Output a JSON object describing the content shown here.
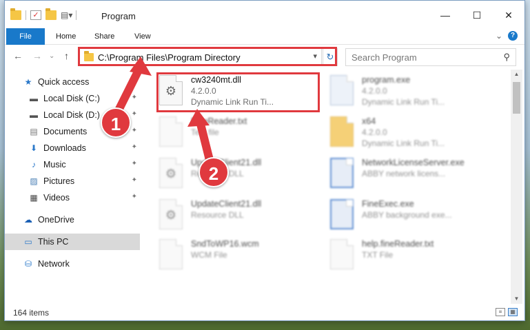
{
  "window": {
    "title": "Program",
    "controls": {
      "minimize": "—",
      "maximize": "☐",
      "close": "✕"
    }
  },
  "ribbon": {
    "tabs": [
      "File",
      "Home",
      "Share",
      "View"
    ],
    "help": "?",
    "collapse": "⌄"
  },
  "nav": {
    "back": "←",
    "forward": "→",
    "recent": "⌄",
    "up": "↑",
    "address": "C:\\Program Files\\Program Directory",
    "refresh": "↻"
  },
  "search": {
    "placeholder": "Search Program",
    "icon": "⚲"
  },
  "sidebar": {
    "items": [
      {
        "label": "Quick access",
        "icon": "star-icon",
        "glyph": "★",
        "pinned": false
      },
      {
        "label": "Local Disk (C:)",
        "icon": "drive-icon",
        "glyph": "▬",
        "pinned": true
      },
      {
        "label": "Local Disk (D:)",
        "icon": "drive-icon",
        "glyph": "▬",
        "pinned": true
      },
      {
        "label": "Documents",
        "icon": "documents-icon",
        "glyph": "▤",
        "pinned": true
      },
      {
        "label": "Downloads",
        "icon": "download-icon",
        "glyph": "⬇",
        "pinned": true
      },
      {
        "label": "Music",
        "icon": "music-icon",
        "glyph": "♪",
        "pinned": true
      },
      {
        "label": "Pictures",
        "icon": "pictures-icon",
        "glyph": "▨",
        "pinned": true
      },
      {
        "label": "Videos",
        "icon": "videos-icon",
        "glyph": "▦",
        "pinned": true
      },
      {
        "label": "OneDrive",
        "icon": "cloud-icon",
        "glyph": "☁",
        "pinned": false
      },
      {
        "label": "This PC",
        "icon": "computer-icon",
        "glyph": "▭",
        "pinned": false,
        "selected": true
      },
      {
        "label": "Network",
        "icon": "network-icon",
        "glyph": "⛁",
        "pinned": false
      }
    ],
    "pin_glyph": "📌"
  },
  "files": [
    {
      "name": "cw3240mt.dll",
      "line2": "4.2.0.0",
      "line3": "Dynamic Link Run Ti...",
      "icon": "gear-file-icon",
      "highlight": true
    },
    {
      "name": "program.exe",
      "line2": "4.2.0.0",
      "line3": "Dynamic Link Run Ti...",
      "icon": "exe-icon"
    },
    {
      "name": "FineReader.txt",
      "line2": "Text file",
      "line3": "",
      "icon": "text-file-icon"
    },
    {
      "name": "x64",
      "line2": "4.2.0.0",
      "line3": "Dynamic Link Run Ti...",
      "icon": "folder-icon"
    },
    {
      "name": "UpdateClient21.dll",
      "line2": "Resource DLL",
      "line3": "",
      "icon": "gear-file-icon"
    },
    {
      "name": "NetworkLicenseServer.exe",
      "line2": "ABBY network licens...",
      "line3": "",
      "icon": "app-icon"
    },
    {
      "name": "UpdateClient21.dll",
      "line2": "Resource DLL",
      "line3": "",
      "icon": "gear-file-icon"
    },
    {
      "name": "FineExec.exe",
      "line2": "ABBY background exe...",
      "line3": "",
      "icon": "app-icon"
    },
    {
      "name": "SndToWP16.wcm",
      "line2": "WCM File",
      "line3": "",
      "icon": "blank-file-icon"
    },
    {
      "name": "help.fineReader.txt",
      "line2": "TXT File",
      "line3": "",
      "icon": "blank-file-icon"
    }
  ],
  "status": {
    "count": "164 items"
  },
  "callouts": {
    "step1": "1",
    "step2": "2"
  },
  "colors": {
    "accent": "#1979ca",
    "callout": "#e0393e"
  }
}
